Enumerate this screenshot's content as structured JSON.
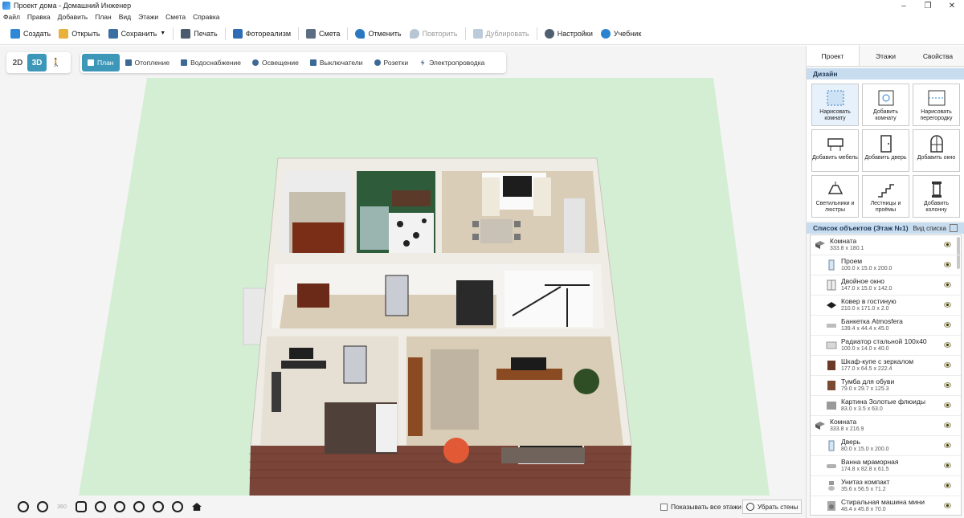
{
  "window": {
    "title": "Проект дома - Домашний Инженер",
    "minimize_glyph": "–",
    "maximize_glyph": "❐",
    "close_glyph": "✕"
  },
  "menu": [
    "Файл",
    "Правка",
    "Добавить",
    "План",
    "Вид",
    "Этажи",
    "Смета",
    "Справка"
  ],
  "toolbar": {
    "create": "Создать",
    "open": "Открыть",
    "save": "Сохранить",
    "save_caret": "▼",
    "print": "Печать",
    "photorealism": "Фотореализм",
    "estimate": "Смета",
    "undo": "Отменить",
    "redo": "Повторить",
    "duplicate": "Дублировать",
    "settings": "Настройки",
    "tutorial": "Учебник"
  },
  "view_modes": {
    "mode_2d": "2D",
    "mode_3d": "3D",
    "walk_glyph": "🚶"
  },
  "layers": [
    "План",
    "Отопление",
    "Водоснабжение",
    "Освещение",
    "Выключатели",
    "Розетки",
    "Электропроводка"
  ],
  "bottom": {
    "show_all_floors": "Показывать все этажи",
    "remove_walls": "Убрать стены",
    "rotate_label": "360"
  },
  "panel": {
    "tabs": [
      "Проект",
      "Этажи",
      "Свойства"
    ],
    "design_header": "Дизайн",
    "design_buttons": [
      "Нарисовать комнату",
      "Добавить комнату",
      "Нарисовать перегородку",
      "Добавить мебель",
      "Добавить дверь",
      "Добавить окно",
      "Светильники и люстры",
      "Лестницы и проёмы",
      "Добавить колонну"
    ],
    "objects_header": "Список объектов (Этаж №1)",
    "list_view": "Вид списка",
    "objects": [
      {
        "name": "Комната",
        "dims": "333.8 x 180.1",
        "level": "top"
      },
      {
        "name": "Проем",
        "dims": "100.0 x 15.0 x 200.0",
        "level": "child"
      },
      {
        "name": "Двойное окно",
        "dims": "147.0 x 15.0 x 142.0",
        "level": "child"
      },
      {
        "name": "Ковер в гостиную",
        "dims": "210.0 x 171.0 x 2.0",
        "level": "child"
      },
      {
        "name": "Банкетка Atmosfera",
        "dims": "139.4 x 44.4 x 45.0",
        "level": "child"
      },
      {
        "name": "Радиатор стальной 100x40",
        "dims": "100.0 x 14.0 x 40.0",
        "level": "child"
      },
      {
        "name": "Шкаф-купе с зеркалом",
        "dims": "177.0 x 64.5 x 222.4",
        "level": "child"
      },
      {
        "name": "Тумба для обуви",
        "dims": "79.0 x 29.7 x 125.3",
        "level": "child"
      },
      {
        "name": "Картина Золотые флюиды",
        "dims": "83.0 x 3.5 x 63.0",
        "level": "child"
      },
      {
        "name": "Комната",
        "dims": "333.8 x 216.9",
        "level": "top"
      },
      {
        "name": "Дверь",
        "dims": "80.0 x 15.0 x 200.0",
        "level": "child"
      },
      {
        "name": "Ванна мраморная",
        "dims": "174.8 x 82.8 x 61.5",
        "level": "child"
      },
      {
        "name": "Унитаз компакт",
        "dims": "35.6 x 56.5 x 71.2",
        "level": "child"
      },
      {
        "name": "Стиральная машина мини",
        "dims": "48.4 x 45.8 x 70.0",
        "level": "child"
      }
    ]
  },
  "colors": {
    "accent": "#3d97b8",
    "ground": "#d4eed4",
    "brick": "#7a4438",
    "floor": "#d9cdb7"
  }
}
